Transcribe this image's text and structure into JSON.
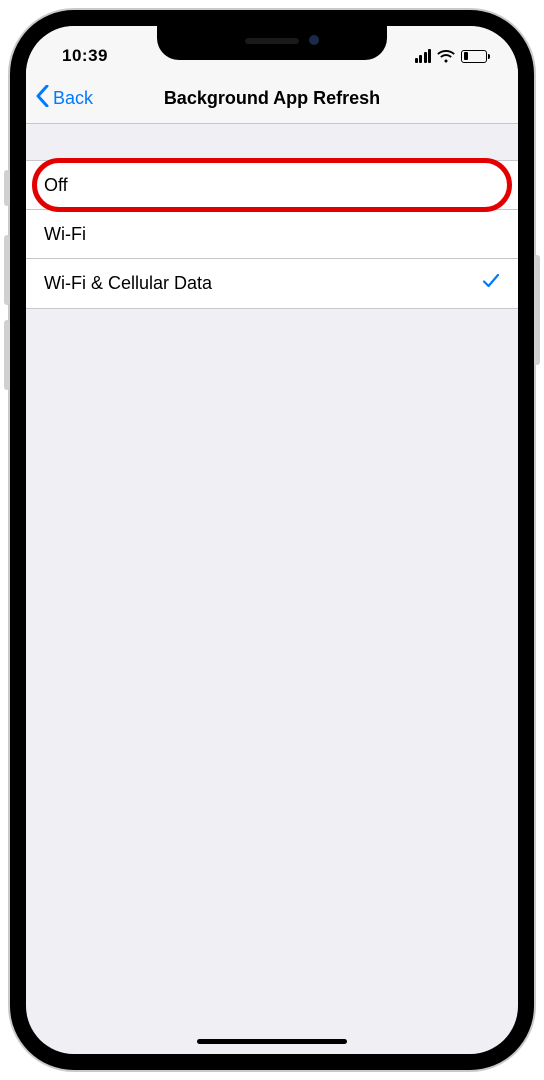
{
  "status_bar": {
    "time": "10:39"
  },
  "nav": {
    "back_label": "Back",
    "title": "Background App Refresh"
  },
  "options": [
    {
      "label": "Off",
      "selected": false,
      "highlighted": true
    },
    {
      "label": "Wi-Fi",
      "selected": false,
      "highlighted": false
    },
    {
      "label": "Wi-Fi & Cellular Data",
      "selected": true,
      "highlighted": false
    }
  ],
  "colors": {
    "accent": "#007aff",
    "highlight": "#e20000",
    "background": "#efeff4"
  }
}
